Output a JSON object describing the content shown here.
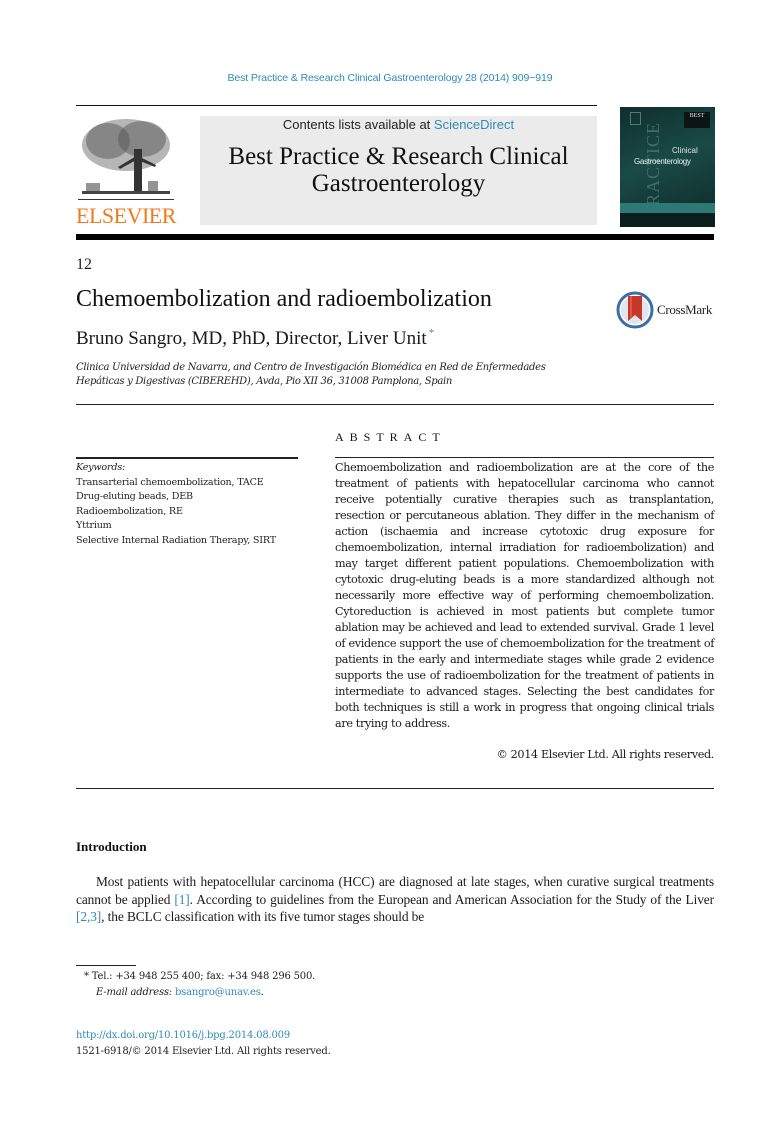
{
  "header": {
    "journal_reference": "Best Practice & Research Clinical Gastroenterology 28 (2014) 909−919",
    "contents_prefix": "Contents lists available at ",
    "contents_link": "ScienceDirect",
    "journal_title_line1": "Best Practice & Research Clinical",
    "journal_title_line2": "Gastroenterology",
    "publisher_logo_text": "ELSEVIER",
    "cover": {
      "badge": "BEST",
      "series_vertical": "PRACTICE",
      "subtitle": "Clinical",
      "title": "Gastroenterology"
    }
  },
  "article": {
    "chapter_number": "12",
    "title": "Chemoembolization and radioembolization",
    "crossmark_label": "CrossMark",
    "author": "Bruno Sangro, MD, PhD, Director, Liver Unit",
    "author_marker": "*",
    "affiliation_line1": "Clinica Universidad de Navarra, and Centro de Investigación Biomédica en Red de Enfermedades",
    "affiliation_line2": "Hepáticas y Digestivas (CIBEREHD), Avda, Pio XII 36, 31008 Pamplona, Spain"
  },
  "keywords": {
    "label": "Keywords:",
    "items": [
      "Transarterial chemoembolization, TACE",
      "Drug-eluting beads, DEB",
      "Radioembolization, RE",
      "Yttrium",
      "Selective Internal Radiation Therapy, SIRT"
    ]
  },
  "abstract": {
    "heading": "ABSTRACT",
    "text": "Chemoembolization and radioembolization are at the core of the treatment of patients with hepatocellular carcinoma who cannot receive potentially curative therapies such as transplantation, resection or percutaneous ablation. They differ in the mechanism of action (ischaemia and increase cytotoxic drug exposure for chemoembolization, internal irradiation for radioembolization) and may target different patient populations. Chemoembolization with cytotoxic drug-eluting beads is a more standardized although not necessarily more effective way of performing chemo­embolization. Cytoreduction is achieved in most patients but complete tumor ablation may be achieved and lead to extended survival. Grade 1 level of evidence support the use of chemo­embolization for the treatment of patients in the early and inter­mediate stages while grade 2 evidence supports the use of radioembolization for the treatment of patients in intermediate to advanced stages. Selecting the best candidates for both techniques is still a work in progress that ongoing clinical trials are trying to address.",
    "copyright": "© 2014 Elsevier Ltd. All rights reserved."
  },
  "introduction": {
    "heading": "Introduction",
    "part1": "Most patients with hepatocellular carcinoma (HCC) are diagnosed at late stages, when curative surgical treatments cannot be applied ",
    "ref1": "[1]",
    "part2": ". According to guidelines from the European and American Association for the Study of the Liver ",
    "ref2": "[2,3]",
    "part3": ", the BCLC classification with its five tumor stages should be"
  },
  "footnote": {
    "marker": "*",
    "contact": "Tel.: +34 948 255 400; fax: +34 948 296 500.",
    "email_label": "E-mail address:",
    "email": "bsangro@unav.es",
    "email_suffix": "."
  },
  "doi": {
    "link": "http://dx.doi.org/10.1016/j.bpg.2014.08.009",
    "issn_copyright": "1521-6918/© 2014 Elsevier Ltd. All rights reserved."
  },
  "colors": {
    "link": "#2e8bb8",
    "elsevier_orange": "#f07a1b",
    "masthead_bg": "#ebebeb",
    "cover_teal": "#1a4a47",
    "crossmark_red": "#c8382a",
    "crossmark_blue": "#3a6ea5"
  }
}
